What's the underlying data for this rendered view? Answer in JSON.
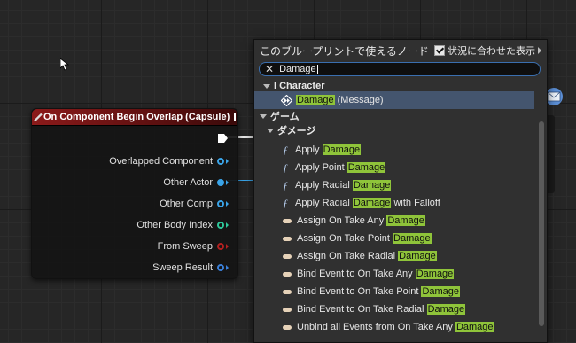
{
  "node": {
    "title": "On Component Begin Overlap (Capsule)",
    "pins": [
      {
        "label": "Overlapped Component",
        "color": "#3aa4e8",
        "filled": false
      },
      {
        "label": "Other Actor",
        "color": "#3aa4e8",
        "filled": true
      },
      {
        "label": "Other Comp",
        "color": "#3aa4e8",
        "filled": false
      },
      {
        "label": "Other Body Index",
        "color": "#2ec79a",
        "filled": false
      },
      {
        "label": "From Sweep",
        "color": "#b32020",
        "filled": false
      },
      {
        "label": "Sweep Result",
        "color": "#3a7fd8",
        "filled": false
      }
    ]
  },
  "menu": {
    "title": "このブループリントで使えるノード",
    "context_label": "状況に合わせた表示",
    "search_value": "Damage",
    "categories": {
      "character": "I Character",
      "game": "ゲーム",
      "damage": "ダメージ"
    },
    "message_item": {
      "match": "Damage",
      "rest": " (Message)"
    },
    "items": [
      {
        "icon": "function",
        "pre": "Apply ",
        "match": "Damage",
        "post": ""
      },
      {
        "icon": "function",
        "pre": "Apply Point ",
        "match": "Damage",
        "post": ""
      },
      {
        "icon": "function",
        "pre": "Apply Radial ",
        "match": "Damage",
        "post": ""
      },
      {
        "icon": "function",
        "pre": "Apply Radial ",
        "match": "Damage",
        "post": " with Falloff"
      },
      {
        "icon": "event",
        "pre": "Assign On Take Any ",
        "match": "Damage",
        "post": ""
      },
      {
        "icon": "event",
        "pre": "Assign On Take Point ",
        "match": "Damage",
        "post": ""
      },
      {
        "icon": "event",
        "pre": "Assign On Take Radial ",
        "match": "Damage",
        "post": ""
      },
      {
        "icon": "event",
        "pre": "Bind Event to On Take Any ",
        "match": "Damage",
        "post": ""
      },
      {
        "icon": "event",
        "pre": "Bind Event to On Take Point ",
        "match": "Damage",
        "post": ""
      },
      {
        "icon": "event",
        "pre": "Bind Event to On Take Radial ",
        "match": "Damage",
        "post": ""
      },
      {
        "icon": "event",
        "pre": "Unbind all Events from On Take Any ",
        "match": "Damage",
        "post": ""
      }
    ]
  },
  "colors": {
    "highlight": "#8fc43a",
    "selection": "#44556e",
    "node_header": "#8b1a1a"
  }
}
